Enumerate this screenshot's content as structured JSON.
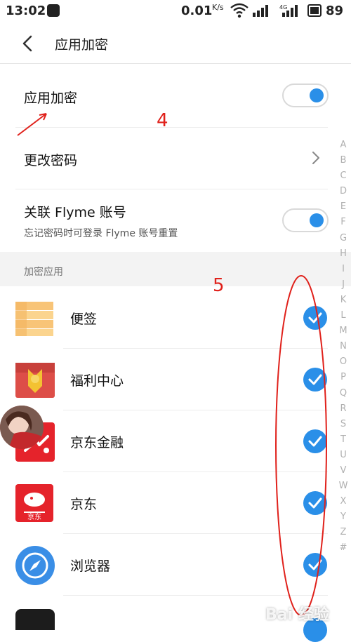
{
  "status_bar": {
    "time": "13:02",
    "speed": "0.01",
    "speed_unit": "K/s",
    "battery": "89"
  },
  "header": {
    "title": "应用加密"
  },
  "settings": {
    "app_lock": {
      "label": "应用加密",
      "enabled": true
    },
    "change_password": {
      "label": "更改密码"
    },
    "link_flyme": {
      "label": "关联 Flyme 账号",
      "sublabel": "忘记密码时可登录 Flyme 账号重置",
      "enabled": true
    }
  },
  "section": {
    "title": "加密应用"
  },
  "apps": [
    {
      "name": "便签",
      "icon": "notes-app-icon",
      "checked": true
    },
    {
      "name": "福利中心",
      "icon": "gift-center-app-icon",
      "checked": true
    },
    {
      "name": "京东金融",
      "icon": "jd-finance-app-icon",
      "checked": true
    },
    {
      "name": "京东",
      "icon": "jd-app-icon",
      "checked": true
    },
    {
      "name": "浏览器",
      "icon": "browser-app-icon",
      "checked": true
    }
  ],
  "alpha_index": [
    "A",
    "B",
    "C",
    "D",
    "E",
    "F",
    "G",
    "H",
    "I",
    "J",
    "K",
    "L",
    "M",
    "N",
    "O",
    "P",
    "Q",
    "R",
    "S",
    "T",
    "U",
    "V",
    "W",
    "X",
    "Y",
    "Z",
    "#"
  ],
  "annotations": {
    "step4": "4",
    "step5": "5"
  },
  "watermark": "Bai 经验",
  "colors": {
    "accent": "#2a8fe8",
    "annotation": "#e0211b"
  }
}
